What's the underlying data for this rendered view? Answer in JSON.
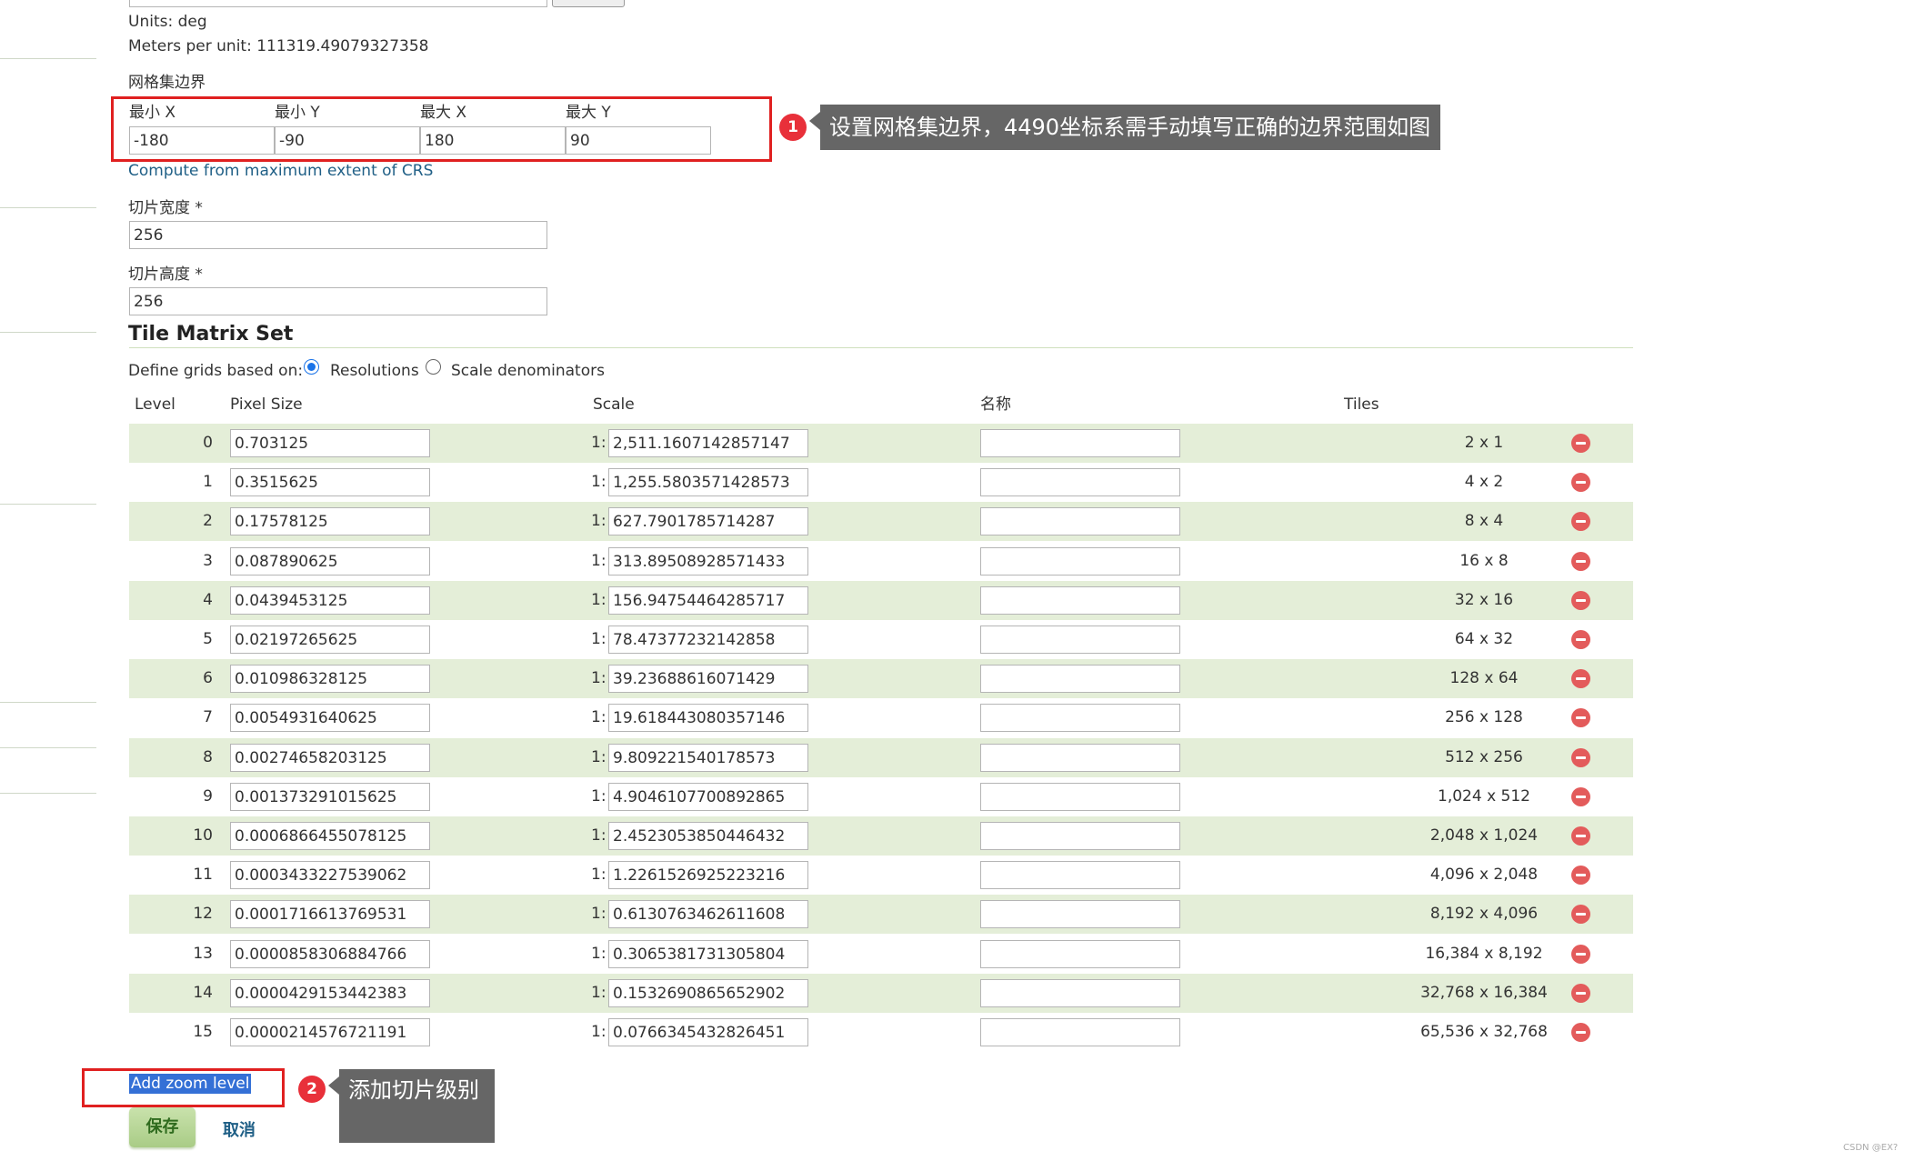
{
  "crs": {
    "units_text": "Units: deg",
    "meters_text": "Meters per unit: 111319.49079327358"
  },
  "bounds": {
    "section_label": "网格集边界",
    "minx_label": "最小 X",
    "miny_label": "最小 Y",
    "maxx_label": "最大 X",
    "maxy_label": "最大 Y",
    "minx": "-180",
    "miny": "-90",
    "maxx": "180",
    "maxy": "90",
    "compute_link": "Compute from maximum extent of CRS"
  },
  "tile_width": {
    "label": "切片宽度 *",
    "value": "256"
  },
  "tile_height": {
    "label": "切片高度 *",
    "value": "256"
  },
  "matrix": {
    "title": "Tile Matrix Set",
    "define_label": "Define grids based on:",
    "option_resolutions": "Resolutions",
    "option_scale": "Scale denominators",
    "selected_option": "Resolutions",
    "col_level": "Level",
    "col_pixel": "Pixel Size",
    "col_scale": "Scale",
    "col_name": "名称",
    "col_tiles": "Tiles",
    "scale_prefix": "1:",
    "rows": [
      {
        "level": "0",
        "pixel": "0.703125",
        "scale": "2,511.1607142857147",
        "name": "",
        "tiles": "2 x 1"
      },
      {
        "level": "1",
        "pixel": "0.3515625",
        "scale": "1,255.5803571428573",
        "name": "",
        "tiles": "4 x 2"
      },
      {
        "level": "2",
        "pixel": "0.17578125",
        "scale": "627.7901785714287",
        "name": "",
        "tiles": "8 x 4"
      },
      {
        "level": "3",
        "pixel": "0.087890625",
        "scale": "313.89508928571433",
        "name": "",
        "tiles": "16 x 8"
      },
      {
        "level": "4",
        "pixel": "0.0439453125",
        "scale": "156.94754464285717",
        "name": "",
        "tiles": "32 x 16"
      },
      {
        "level": "5",
        "pixel": "0.02197265625",
        "scale": "78.47377232142858",
        "name": "",
        "tiles": "64 x 32"
      },
      {
        "level": "6",
        "pixel": "0.010986328125",
        "scale": "39.23688616071429",
        "name": "",
        "tiles": "128 x 64"
      },
      {
        "level": "7",
        "pixel": "0.0054931640625",
        "scale": "19.618443080357146",
        "name": "",
        "tiles": "256 x 128"
      },
      {
        "level": "8",
        "pixel": "0.00274658203125",
        "scale": "9.809221540178573",
        "name": "",
        "tiles": "512 x 256"
      },
      {
        "level": "9",
        "pixel": "0.001373291015625",
        "scale": "4.9046107700892865",
        "name": "",
        "tiles": "1,024 x 512"
      },
      {
        "level": "10",
        "pixel": "0.0006866455078125",
        "scale": "2.4523053850446432",
        "name": "",
        "tiles": "2,048 x 1,024"
      },
      {
        "level": "11",
        "pixel": "0.0003433227539062",
        "scale": "1.2261526925223216",
        "name": "",
        "tiles": "4,096 x 2,048"
      },
      {
        "level": "12",
        "pixel": "0.0001716613769531",
        "scale": "0.6130763462611608",
        "name": "",
        "tiles": "8,192 x 4,096"
      },
      {
        "level": "13",
        "pixel": "0.0000858306884766",
        "scale": "0.3065381731305804",
        "name": "",
        "tiles": "16,384 x 8,192"
      },
      {
        "level": "14",
        "pixel": "0.0000429153442383",
        "scale": "0.1532690865652902",
        "name": "",
        "tiles": "32,768 x 16,384"
      },
      {
        "level": "15",
        "pixel": "0.0000214576721191",
        "scale": "0.0766345432826451",
        "name": "",
        "tiles": "65,536 x 32,768"
      }
    ],
    "add_zoom": "Add zoom level"
  },
  "actions": {
    "save": "保存",
    "cancel": "取消"
  },
  "annotations": {
    "badge1": "1",
    "callout1": "设置网格集边界，4490坐标系需手动填写正确的边界范围如图",
    "badge2": "2",
    "callout2": "添加切片级别"
  },
  "watermark": "CSDN @EX?",
  "colors": {
    "row_alt": "#e4eed8",
    "link": "#1f5f86",
    "annotation_red": "#e02020",
    "callout_bg": "#666666",
    "save_green": "#a9cc86"
  },
  "icons": [
    "remove-row-icon",
    "radio-selected",
    "radio-unselected"
  ]
}
